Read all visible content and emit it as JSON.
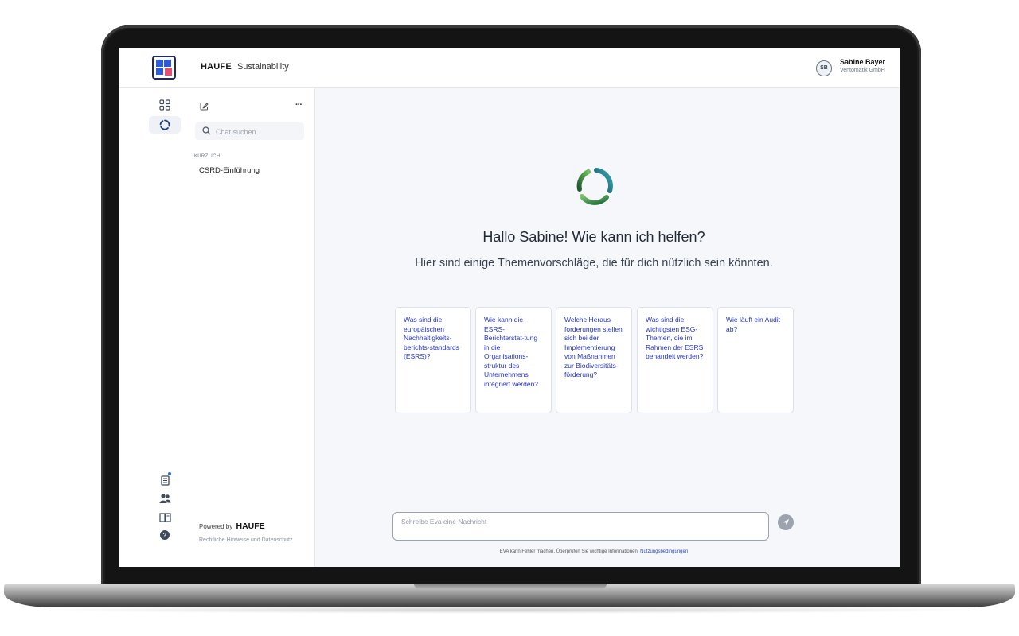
{
  "header": {
    "brand": "HAUFE",
    "app_name": "Sustainability",
    "user": {
      "initials": "SB",
      "name": "Sabine Bayer",
      "company": "Ventomatik GmbH"
    }
  },
  "rail": {
    "items": [
      {
        "icon": "apps-grid-icon"
      },
      {
        "icon": "eva-assistant-icon",
        "active": true
      }
    ],
    "bottom_items": [
      {
        "icon": "news-icon",
        "has_notification": true
      },
      {
        "icon": "users-icon"
      },
      {
        "icon": "book-icon"
      },
      {
        "icon": "help-icon"
      }
    ]
  },
  "chat_sidebar": {
    "new_chat_icon": "new-chat-icon",
    "more_label": "···",
    "search_placeholder": "Chat suchen",
    "section_label": "KÜRZLICH",
    "recent": [
      "CSRD-Einführung"
    ],
    "powered_by_prefix": "Powered by",
    "powered_by_brand": "HAUFE",
    "legal": "Rechtliche Hinweise und Datenschutz"
  },
  "main": {
    "greeting": "Hallo Sabine! Wie kann ich helfen?",
    "subgreeting": "Hier sind einige Themenvorschläge, die für dich nützlich sein könnten.",
    "suggestions": [
      "Was sind die europäischen Nachhaltigkeits-berichts-standards (ESRS)?",
      "Wie kann die ESRS-Berichterstat-tung in die Organisations-struktur des Unternehmens integriert werden?",
      "Welche Heraus-forderungen stellen sich bei der Implementierung von Maßnahmen zur Biodiversitäts-förderung?",
      "Was sind die wichtigsten ESG-Themen, die im Rahmen der ESRS behandelt werden?",
      "Wie läuft ein Audit ab?"
    ],
    "composer": {
      "placeholder": "Schreibe Eva eine Nachricht",
      "value": ""
    },
    "disclaimer": "EVA kann Fehler machen. Überprüfen Sie wichtige Informationen.",
    "disclaimer_link": "Nutzungsbedingungen"
  },
  "colors": {
    "accent": "#2434c8",
    "brand_blue": "#2f5bd6",
    "brand_pink": "#e84f6e",
    "main_bg": "#f5f7fb",
    "eva_green": "#2e7d32"
  }
}
